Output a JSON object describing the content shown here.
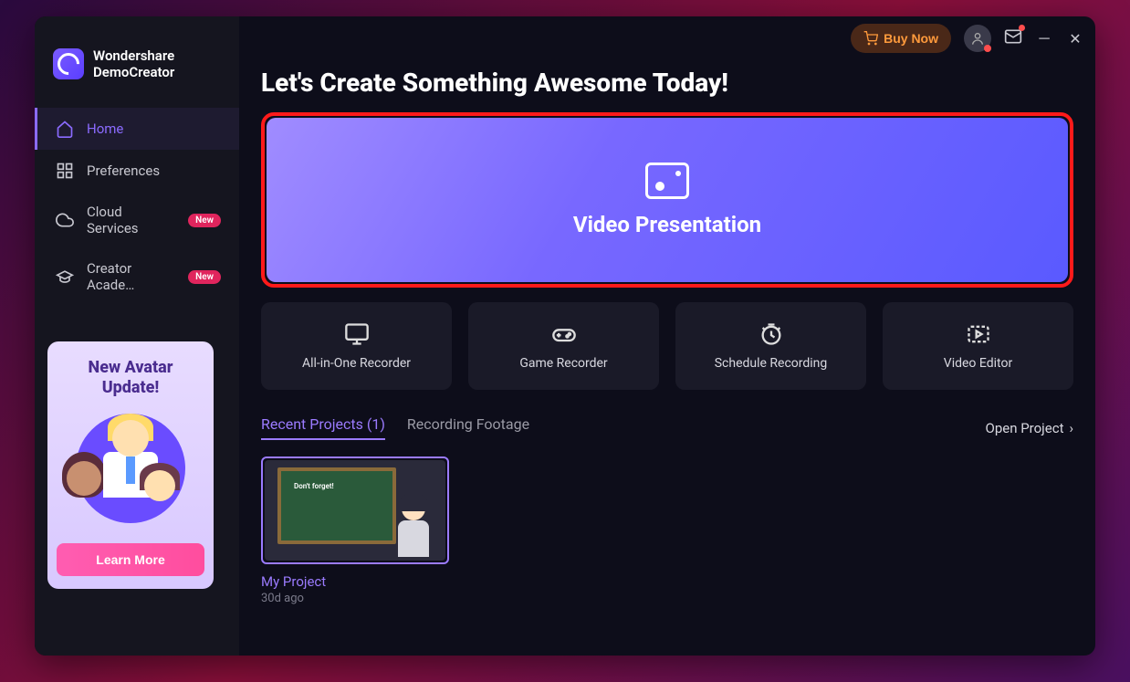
{
  "brand": {
    "line1": "Wondershare",
    "line2": "DemoCreator"
  },
  "sidebar": {
    "items": [
      {
        "label": "Home",
        "icon": "home-icon"
      },
      {
        "label": "Preferences",
        "icon": "grid-icon"
      },
      {
        "label": "Cloud Services",
        "icon": "cloud-icon",
        "badge": "New"
      },
      {
        "label": "Creator Acade…",
        "icon": "academy-icon",
        "badge": "New"
      }
    ]
  },
  "promo": {
    "title_l1": "New Avatar",
    "title_l2": "Update!",
    "cta": "Learn More"
  },
  "topbar": {
    "buy": "Buy Now"
  },
  "heading": "Let's Create Something Awesome Today!",
  "hero": {
    "label": "Video Presentation"
  },
  "cards": [
    {
      "label": "All-in-One Recorder"
    },
    {
      "label": "Game Recorder"
    },
    {
      "label": "Schedule Recording"
    },
    {
      "label": "Video Editor"
    }
  ],
  "tabs": {
    "recent": "Recent Projects (1)",
    "footage": "Recording Footage",
    "open": "Open Project"
  },
  "projects": [
    {
      "name": "My Project",
      "date": "30d ago",
      "thumb_text": "Don't forget!"
    }
  ]
}
